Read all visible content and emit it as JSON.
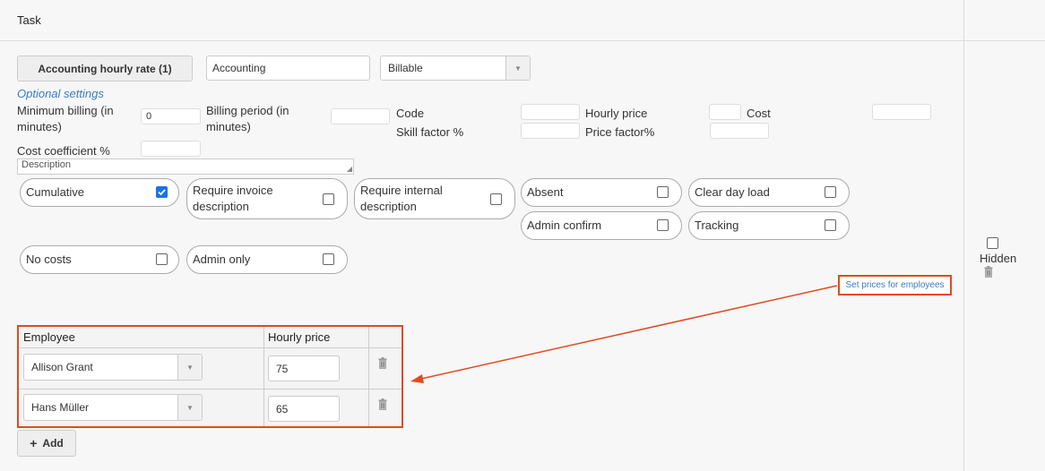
{
  "header": {
    "title": "Task"
  },
  "task": {
    "name_button": "Accounting hourly rate (1)",
    "name_value": "Accounting",
    "billing_type": "Billable"
  },
  "optional": {
    "link": "Optional settings",
    "min_billing_label": "Minimum billing (in minutes)",
    "min_billing_value": "0",
    "billing_period_label": "Billing period (in minutes)",
    "billing_period_value": "",
    "code_label": "Code",
    "code_value": "",
    "hourly_price_label": "Hourly price",
    "hourly_price_value": "",
    "cost_label": "Cost",
    "cost_value": "",
    "skill_factor_label": "Skill factor %",
    "skill_factor_value": "",
    "price_factor_label": "Price factor%",
    "price_factor_value": "",
    "cost_coefficient_label": "Cost coefficient %",
    "cost_coefficient_value": "",
    "description_placeholder": "Description"
  },
  "options": [
    {
      "label": "Cumulative",
      "checked": true
    },
    {
      "label": "Require invoice description",
      "checked": false
    },
    {
      "label": "Require internal description",
      "checked": false
    },
    {
      "label": "Absent",
      "checked": false
    },
    {
      "label": "Clear day load",
      "checked": false
    },
    {
      "label": "Admin confirm",
      "checked": false
    },
    {
      "label": "Tracking",
      "checked": false
    },
    {
      "label": "No costs",
      "checked": false
    },
    {
      "label": "Admin only",
      "checked": false
    }
  ],
  "set_prices_link": "Set prices for employees",
  "side": {
    "hidden_label": "Hidden",
    "hidden_checked": false
  },
  "employees": {
    "headers": {
      "employee": "Employee",
      "hourly_price": "Hourly price"
    },
    "rows": [
      {
        "name": "Allison Grant",
        "price": "75"
      },
      {
        "name": "Hans Müller",
        "price": "65"
      }
    ],
    "add_label": "Add"
  },
  "colors": {
    "accent": "#3a7bbf",
    "highlight": "#e04b20",
    "checkbox": "#1a73e8"
  }
}
